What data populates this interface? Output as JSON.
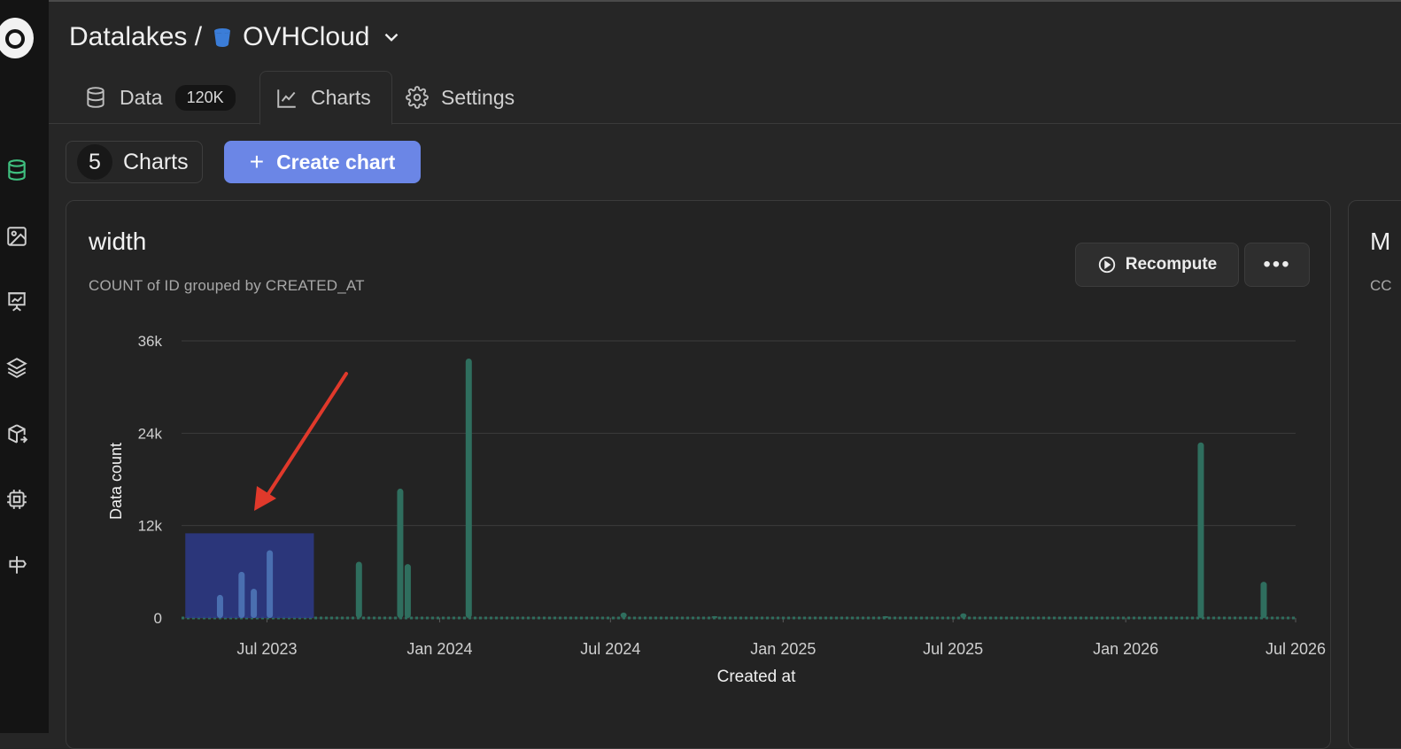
{
  "app": {
    "breadcrumb_root": "Datalakes /",
    "datalake_name": "OVHCloud"
  },
  "tabs": [
    {
      "label": "Data",
      "badge": "120K",
      "icon": "database-icon"
    },
    {
      "label": "Charts",
      "icon": "line-chart-icon",
      "active": true
    },
    {
      "label": "Settings",
      "icon": "gear-icon"
    }
  ],
  "toolbar": {
    "charts_count": "5",
    "charts_label": "Charts",
    "create_label": "Create chart"
  },
  "sidebar": {
    "items": [
      "database-icon",
      "image-icon",
      "presentation-chart-icon",
      "layers-icon",
      "box-export-icon",
      "cpu-icon",
      "signpost-icon"
    ]
  },
  "chart_card": {
    "title": "width",
    "subtitle": "COUNT of ID grouped by CREATED_AT",
    "recompute_label": "Recompute",
    "more_label": "•••"
  },
  "next_card": {
    "title": "M",
    "subtitle": "CC"
  },
  "colors": {
    "bar": "#2f6e5e",
    "selection": "#2d3a8a",
    "selected_bar": "#4a6fb0",
    "annotation_arrow": "#e0392b",
    "accent": "#6b86e6"
  },
  "chart_data": {
    "type": "bar",
    "xlabel": "Created at",
    "ylabel": "Data count",
    "ylim": [
      0,
      36000
    ],
    "y_ticks": [
      {
        "value": 0,
        "label": "0"
      },
      {
        "value": 12000,
        "label": "12k"
      },
      {
        "value": 24000,
        "label": "24k"
      },
      {
        "value": 36000,
        "label": "36k"
      }
    ],
    "x_ticks": [
      {
        "date": "2023-07-01",
        "label": "Jul 2023"
      },
      {
        "date": "2024-01-01",
        "label": "Jan 2024"
      },
      {
        "date": "2024-07-01",
        "label": "Jul 2024"
      },
      {
        "date": "2025-01-01",
        "label": "Jan 2025"
      },
      {
        "date": "2025-07-01",
        "label": "Jul 2025"
      },
      {
        "date": "2026-01-01",
        "label": "Jan 2026"
      },
      {
        "date": "2026-07-01",
        "label": "Jul 2026"
      }
    ],
    "xlim": [
      "2023-04-01",
      "2026-07-01"
    ],
    "grid": true,
    "selection": {
      "from": "2023-04-05",
      "to": "2023-08-20",
      "y_top": 11000
    },
    "bars": [
      {
        "date": "2023-05-12",
        "value": 3000,
        "selected": true
      },
      {
        "date": "2023-06-04",
        "value": 6000,
        "selected": true
      },
      {
        "date": "2023-06-17",
        "value": 3800,
        "selected": true
      },
      {
        "date": "2023-07-04",
        "value": 8800,
        "selected": true
      },
      {
        "date": "2023-10-07",
        "value": 7300
      },
      {
        "date": "2023-11-20",
        "value": 16800
      },
      {
        "date": "2023-11-28",
        "value": 7000
      },
      {
        "date": "2024-02-01",
        "value": 33700
      },
      {
        "date": "2024-07-15",
        "value": 700
      },
      {
        "date": "2024-10-20",
        "value": 250
      },
      {
        "date": "2025-04-20",
        "value": 250
      },
      {
        "date": "2025-07-12",
        "value": 600
      },
      {
        "date": "2026-03-22",
        "value": 22800
      },
      {
        "date": "2026-05-28",
        "value": 4700
      }
    ]
  }
}
